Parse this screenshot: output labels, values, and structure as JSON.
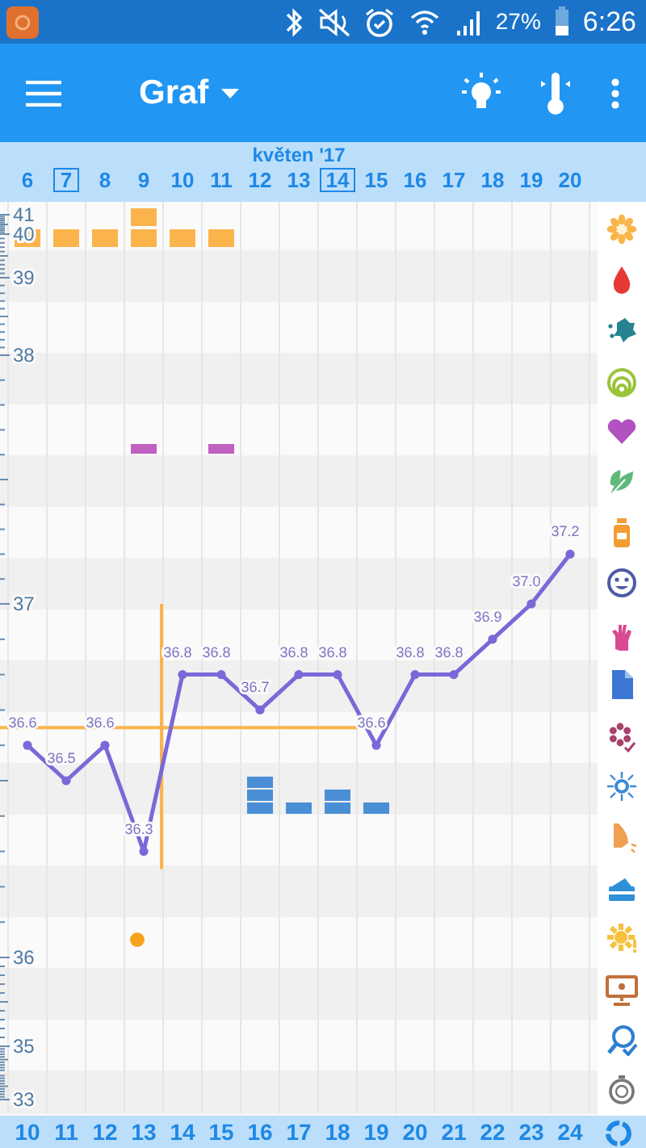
{
  "status_bar": {
    "battery": "27%",
    "time": "6:26"
  },
  "app_bar": {
    "title": "Graf"
  },
  "month": "květen '17",
  "days": [
    {
      "date": "6",
      "boxed": false,
      "selected": false,
      "marks": [
        {
          "kind": "top"
        }
      ]
    },
    {
      "date": "7",
      "boxed": true,
      "selected": false,
      "marks": [
        {
          "kind": "top"
        }
      ]
    },
    {
      "date": "8",
      "boxed": false,
      "selected": false,
      "marks": [
        {
          "kind": "top"
        }
      ]
    },
    {
      "date": "9",
      "boxed": false,
      "selected": true,
      "marks": [
        {
          "kind": "top"
        },
        {
          "kind": "top"
        },
        {
          "kind": "bar"
        },
        {
          "kind": "dot"
        }
      ]
    },
    {
      "date": "10",
      "boxed": false,
      "selected": false,
      "marks": [
        {
          "kind": "top"
        }
      ]
    },
    {
      "date": "11",
      "boxed": false,
      "selected": false,
      "marks": [
        {
          "kind": "top"
        },
        {
          "kind": "bar"
        }
      ]
    },
    {
      "date": "12",
      "boxed": false,
      "selected": false,
      "marks": [
        {
          "kind": "block"
        },
        {
          "kind": "block"
        },
        {
          "kind": "block"
        }
      ]
    },
    {
      "date": "13",
      "boxed": false,
      "selected": false,
      "marks": [
        {
          "kind": "block"
        }
      ]
    },
    {
      "date": "14",
      "boxed": true,
      "selected": false,
      "marks": [
        {
          "kind": "block"
        },
        {
          "kind": "block"
        }
      ]
    },
    {
      "date": "15",
      "boxed": false,
      "selected": false,
      "marks": [
        {
          "kind": "block"
        }
      ]
    },
    {
      "date": "16",
      "boxed": false,
      "selected": false
    },
    {
      "date": "17",
      "boxed": false,
      "selected": false
    },
    {
      "date": "18",
      "boxed": false,
      "selected": false
    },
    {
      "date": "19",
      "boxed": false,
      "selected": false
    },
    {
      "date": "20",
      "boxed": false,
      "selected": false
    }
  ],
  "chart": {
    "axis_labels": [
      "41",
      "40",
      "39",
      "38",
      "37",
      "36",
      "35",
      "33"
    ],
    "cover_line": true,
    "readings": [
      "36.6",
      "36.5",
      "36.6",
      "36.3",
      "36.8",
      "36.8",
      "36.7",
      "36.8",
      "36.8",
      "36.6",
      "36.8",
      "36.8",
      "36.9",
      "37.0",
      "37.2"
    ],
    "cycle_days": [
      "10",
      "11",
      "12",
      "13",
      "14",
      "15",
      "16",
      "17",
      "18",
      "19",
      "20",
      "21",
      "22",
      "23",
      "24"
    ]
  },
  "sidebar": {
    "items": [
      {
        "kind": "flower"
      },
      {
        "kind": "drop"
      },
      {
        "kind": "splash"
      },
      {
        "kind": "rings"
      },
      {
        "kind": "heart"
      },
      {
        "kind": "leaf"
      },
      {
        "kind": "bottle"
      },
      {
        "kind": "smiley"
      },
      {
        "kind": "hand"
      },
      {
        "kind": "document"
      },
      {
        "kind": "blossom"
      },
      {
        "kind": "sparkle"
      },
      {
        "kind": "nose"
      },
      {
        "kind": "cake"
      },
      {
        "kind": "sun"
      },
      {
        "kind": "monitor"
      },
      {
        "kind": "magnifier"
      },
      {
        "kind": "stopwatch"
      }
    ]
  }
}
